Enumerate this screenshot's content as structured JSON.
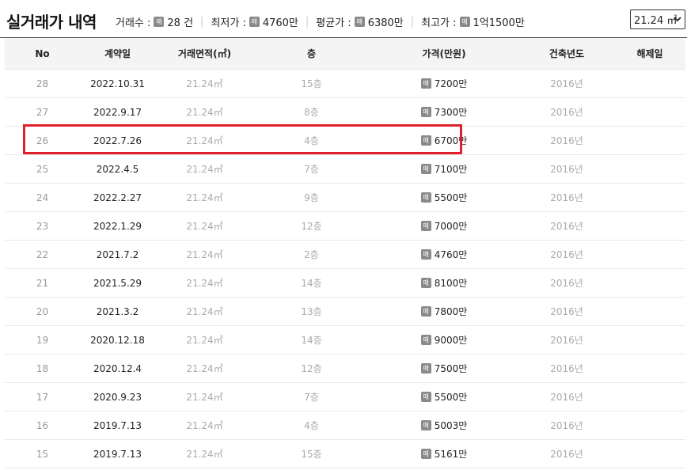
{
  "title": "실거래가 내역",
  "stats": {
    "count_label": "거래수 :",
    "count_value": "28 건",
    "min_label": "최저가 :",
    "min_value": "4760만",
    "avg_label": "평균가 :",
    "avg_value": "6380만",
    "max_label": "최고가 :",
    "max_value": "1억1500만"
  },
  "badge_text": "매",
  "area_select": {
    "value": "21.24 ㎡"
  },
  "columns": [
    "No",
    "계약일",
    "거래면적(㎡)",
    "층",
    "가격(만원)",
    "건축년도",
    "해제일"
  ],
  "rows": [
    {
      "no": "28",
      "date": "2022.10.31",
      "area": "21.24㎡",
      "floor": "15층",
      "price": "7200만",
      "year": "2016년",
      "cancel": ""
    },
    {
      "no": "27",
      "date": "2022.9.17",
      "area": "21.24㎡",
      "floor": "8층",
      "price": "7300만",
      "year": "2016년",
      "cancel": ""
    },
    {
      "no": "26",
      "date": "2022.7.26",
      "area": "21.24㎡",
      "floor": "4층",
      "price": "6700만",
      "year": "2016년",
      "cancel": ""
    },
    {
      "no": "25",
      "date": "2022.4.5",
      "area": "21.24㎡",
      "floor": "7층",
      "price": "7100만",
      "year": "2016년",
      "cancel": ""
    },
    {
      "no": "24",
      "date": "2022.2.27",
      "area": "21.24㎡",
      "floor": "9층",
      "price": "5500만",
      "year": "2016년",
      "cancel": ""
    },
    {
      "no": "23",
      "date": "2022.1.29",
      "area": "21.24㎡",
      "floor": "12층",
      "price": "7000만",
      "year": "2016년",
      "cancel": ""
    },
    {
      "no": "22",
      "date": "2021.7.2",
      "area": "21.24㎡",
      "floor": "2층",
      "price": "4760만",
      "year": "2016년",
      "cancel": ""
    },
    {
      "no": "21",
      "date": "2021.5.29",
      "area": "21.24㎡",
      "floor": "14층",
      "price": "8100만",
      "year": "2016년",
      "cancel": ""
    },
    {
      "no": "20",
      "date": "2021.3.2",
      "area": "21.24㎡",
      "floor": "13층",
      "price": "7800만",
      "year": "2016년",
      "cancel": ""
    },
    {
      "no": "19",
      "date": "2020.12.18",
      "area": "21.24㎡",
      "floor": "14층",
      "price": "9000만",
      "year": "2016년",
      "cancel": ""
    },
    {
      "no": "18",
      "date": "2020.12.4",
      "area": "21.24㎡",
      "floor": "12층",
      "price": "7500만",
      "year": "2016년",
      "cancel": ""
    },
    {
      "no": "17",
      "date": "2020.9.23",
      "area": "21.24㎡",
      "floor": "7층",
      "price": "5500만",
      "year": "2016년",
      "cancel": ""
    },
    {
      "no": "16",
      "date": "2019.7.13",
      "area": "21.24㎡",
      "floor": "4층",
      "price": "5003만",
      "year": "2016년",
      "cancel": ""
    },
    {
      "no": "15",
      "date": "2019.7.13",
      "area": "21.24㎡",
      "floor": "15층",
      "price": "5161만",
      "year": "2016년",
      "cancel": ""
    }
  ],
  "highlight_color": "#e0202a",
  "badge_color": "#8a8a8a"
}
